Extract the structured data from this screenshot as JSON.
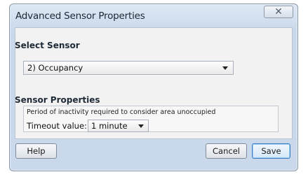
{
  "window": {
    "title": "Advanced Sensor Properties",
    "close_glyph": "✕"
  },
  "select_sensor": {
    "heading": "Select Sensor",
    "selected": "2) Occupancy"
  },
  "sensor_properties": {
    "heading": "Sensor Properties",
    "description": "Period of inactivity required to consider area unoccupied",
    "timeout_label": "Timeout value:",
    "timeout_selected": "1 minute"
  },
  "buttons": {
    "help": "Help",
    "cancel": "Cancel",
    "save": "Save"
  },
  "icons": {
    "close": "close-icon",
    "dropdown": "chevron-down-icon"
  }
}
